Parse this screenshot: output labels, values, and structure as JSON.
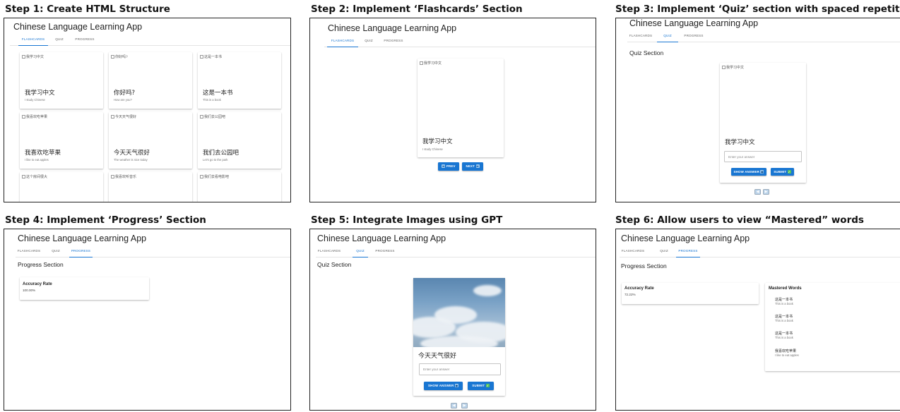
{
  "app_title": "Chinese Language Learning App",
  "tabs": [
    "FLASHCARDS",
    "QUIZ",
    "PROGRESS"
  ],
  "steps": [
    "Step 1: Create HTML Structure",
    "Step 2: Implement ‘Flashcards’ Section",
    "Step 3: Implement ‘Quiz’ section with spaced repetition",
    "Step 4: Implement ‘Progress’ Section",
    "Step 5: Integrate Images using GPT",
    "Step 6: Allow users to view “Mastered” words"
  ],
  "cards": [
    {
      "zh": "我学习中文",
      "en": "I study Chinese"
    },
    {
      "zh": "你好吗?",
      "en": "How are you?"
    },
    {
      "zh": "这是一本书",
      "en": "This is a book"
    },
    {
      "zh": "我喜欢吃苹果",
      "en": "I like to eat apples"
    },
    {
      "zh": "今天天气很好",
      "en": "The weather is nice today"
    },
    {
      "zh": "我们去公园吧",
      "en": "Let's go to the park"
    },
    {
      "zh": "这个房间很大",
      "en": ""
    },
    {
      "zh": "我喜欢听音乐",
      "en": ""
    },
    {
      "zh": "我们去看电影吧",
      "en": ""
    }
  ],
  "flashcard_nav": {
    "prev": "PREV",
    "next": "NEXT"
  },
  "quiz": {
    "section_title": "Quiz Section",
    "placeholder": "Enter your answer",
    "show_answer": "SHOW ANSWER",
    "submit": "SUBMIT",
    "step3_word": "我学习中文",
    "step5_word": "今天天气很好"
  },
  "progress": {
    "section_title": "Progress Section",
    "accuracy_label": "Accuracy Rate",
    "accuracy_step4": "100.00%",
    "accuracy_step6": "72.22%",
    "mastered_title": "Mastered Words",
    "mastered": [
      {
        "zh": "这是一本书",
        "en": "This is a book"
      },
      {
        "zh": "这是一本书",
        "en": "This is a book"
      },
      {
        "zh": "这是一本书",
        "en": "This is a book"
      },
      {
        "zh": "我喜欢吃苹果",
        "en": "I like to eat apples"
      }
    ]
  },
  "colors": {
    "accent": "#1976d2",
    "submit_emoji": "#58c25b"
  },
  "icons": {
    "show_answer": "eye-emoji-icon",
    "submit": "check-emoji-icon",
    "prev": "left-arrow-icon",
    "next": "right-arrow-icon"
  }
}
